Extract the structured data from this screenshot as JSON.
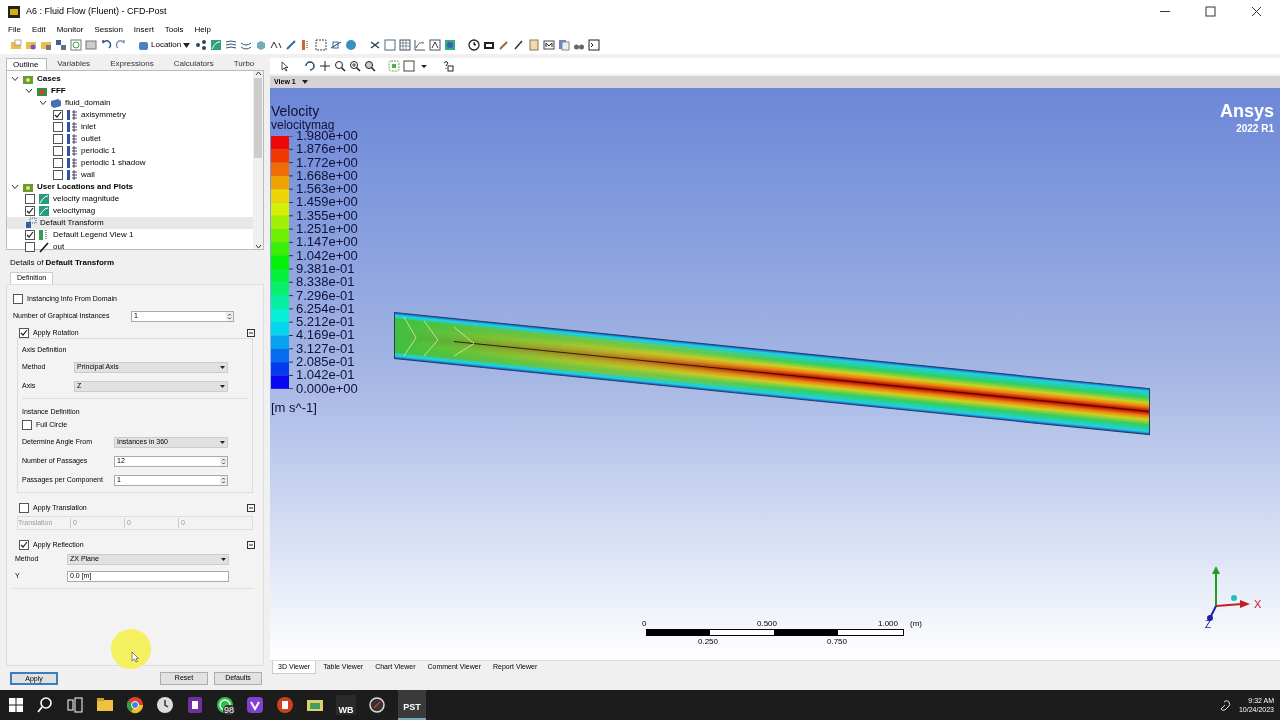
{
  "window": {
    "title": "A6 : Fluid Flow (Fluent) - CFD-Post"
  },
  "menu": [
    "File",
    "Edit",
    "Monitor",
    "Session",
    "Insert",
    "Tools",
    "Help"
  ],
  "toolbar": {
    "location_button": "Location"
  },
  "outline_tabs": [
    {
      "label": "Outline",
      "selected": true
    },
    {
      "label": "Variables",
      "selected": false
    },
    {
      "label": "Expressions",
      "selected": false
    },
    {
      "label": "Calculators",
      "selected": false
    },
    {
      "label": "Turbo",
      "selected": false
    }
  ],
  "tree": [
    {
      "label": "Cases",
      "kind": "group",
      "expanded": true,
      "selected": false,
      "children": [
        {
          "label": "FFF",
          "kind": "case",
          "expanded": true,
          "selected": false,
          "children": [
            {
              "label": "fluid_domain",
              "kind": "domain",
              "expanded": true,
              "selected": false,
              "children": [
                {
                  "label": "axisymmetry",
                  "kind": "boundary",
                  "checked": true,
                  "selected": false
                },
                {
                  "label": "inlet",
                  "kind": "boundary",
                  "checked": false,
                  "selected": false
                },
                {
                  "label": "outlet",
                  "kind": "boundary",
                  "checked": false,
                  "selected": false
                },
                {
                  "label": "periodic 1",
                  "kind": "boundary",
                  "checked": false,
                  "selected": false
                },
                {
                  "label": "periodic 1 shadow",
                  "kind": "boundary",
                  "checked": false,
                  "selected": false
                },
                {
                  "label": "wall",
                  "kind": "boundary",
                  "checked": false,
                  "selected": false
                }
              ]
            }
          ]
        }
      ]
    },
    {
      "label": "User Locations and Plots",
      "kind": "group",
      "expanded": true,
      "selected": false,
      "children": [
        {
          "label": "velocity magnitude",
          "kind": "contour",
          "checked": false,
          "selected": false
        },
        {
          "label": "velocitymag",
          "kind": "contour",
          "checked": true,
          "selected": false
        },
        {
          "label": "Default Transform",
          "kind": "transform",
          "selected": true
        },
        {
          "label": "Default Legend View 1",
          "kind": "legend",
          "checked": true,
          "selected": false
        },
        {
          "label": "out",
          "kind": "line",
          "checked": false,
          "selected": false
        }
      ]
    }
  ],
  "details": {
    "title": "Details of **Default Transform**",
    "tabs": [
      {
        "label": "Definition",
        "selected": true
      }
    ],
    "instancing": {
      "label": "Instancing Info From Domain",
      "checked": false
    },
    "graphical_instances": {
      "label": "Number of Graphical Instances",
      "value": "1"
    },
    "rotation": {
      "label": "Apply Rotation",
      "checked": true,
      "axis_heading": "Axis Definition",
      "method": {
        "label": "Method",
        "value": "Principal Axis"
      },
      "axis": {
        "label": "Axis",
        "value": "Z"
      },
      "instance_heading": "Instance Definition",
      "full_circle": {
        "label": "Full Circle",
        "checked": false
      },
      "angle_from": {
        "label": "Determine Angle From",
        "value": "Instances in 360"
      },
      "passages": {
        "label": "Number of Passages",
        "value": "12"
      },
      "per_component": {
        "label": "Passages per Component",
        "value": "1"
      }
    },
    "translation": {
      "label": "Apply Translation",
      "checked": false,
      "field_label": "Translation",
      "values": [
        "0",
        "0",
        "0"
      ]
    },
    "reflection": {
      "label": "Apply Reflection",
      "checked": true,
      "method": {
        "label": "Method",
        "value": "ZX Plane"
      },
      "y": {
        "label": "Y",
        "value": "0.0 [m]"
      }
    },
    "buttons": [
      {
        "label": "Apply",
        "default": true
      },
      {
        "label": "Reset",
        "default": false
      },
      {
        "label": "Defaults",
        "default": false
      }
    ]
  },
  "viewer": {
    "view_label": "View 1",
    "legend": {
      "title": "Velocity",
      "variable": "velocitymag",
      "levels": [
        "1.980e+00",
        "1.876e+00",
        "1.772e+00",
        "1.668e+00",
        "1.563e+00",
        "1.459e+00",
        "1.355e+00",
        "1.251e+00",
        "1.147e+00",
        "1.042e+00",
        "9.381e-01",
        "8.338e-01",
        "7.296e-01",
        "6.254e-01",
        "5.212e-01",
        "4.169e-01",
        "3.127e-01",
        "2.085e-01",
        "1.042e-01",
        "0.000e+00"
      ],
      "unit": "[m s^-1]"
    },
    "brand": {
      "name": "Ansys",
      "version": "2022 R1"
    },
    "scale": {
      "top_labels": [
        "0",
        "0.500",
        "1.000"
      ],
      "bottom_labels": [
        "0.250",
        "0.750"
      ],
      "unit": "(m)"
    },
    "axes": {
      "x": "X",
      "z": "Z"
    },
    "tabs": [
      {
        "label": "3D Viewer",
        "selected": true
      },
      {
        "label": "Table Viewer",
        "selected": false
      },
      {
        "label": "Chart Viewer",
        "selected": false
      },
      {
        "label": "Comment Viewer",
        "selected": false
      },
      {
        "label": "Report Viewer",
        "selected": false
      }
    ]
  },
  "taskbar": {
    "badge": "98",
    "wb_label": "WB",
    "pst_label": "PST",
    "time": "9:32 AM",
    "date": "10/24/2023"
  }
}
